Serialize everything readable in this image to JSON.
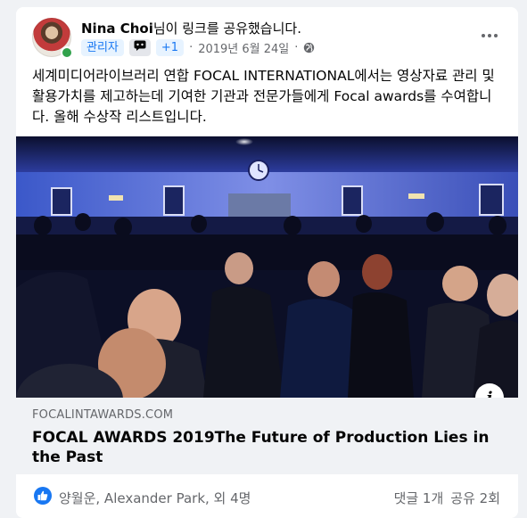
{
  "post": {
    "author": "Nina Choi",
    "action": "님이 링크를 공유했습니다.",
    "role_badge": "관리자",
    "extra_badge": "+1",
    "date": "2019년 6월 24일",
    "separator": "·",
    "text": "세계미디어라이브러리 연합 FOCAL INTERNATIONAL에서는 영상자료 관리 및 활용가치를 제고하는데 기여한 기관과 전문가들에게 Focal awards를 수여합니다. 올해 수상작 리스트입니다."
  },
  "link_preview": {
    "domain": "FOCALINTAWARDS.COM",
    "title": "FOCAL AWARDS 2019The Future of Production Lies in the Past",
    "info_glyph": "i"
  },
  "footer": {
    "reactors": "양월운, Alexander Park, 외 4명",
    "comments": "댓글 1개",
    "shares": "공유 2회"
  },
  "colors": {
    "accent": "#1877f2",
    "online": "#31a24c",
    "secondary_text": "#65676b"
  },
  "icons": [
    "avatar",
    "badge-icon",
    "globe-icon",
    "more-icon",
    "info-icon",
    "like-icon"
  ]
}
